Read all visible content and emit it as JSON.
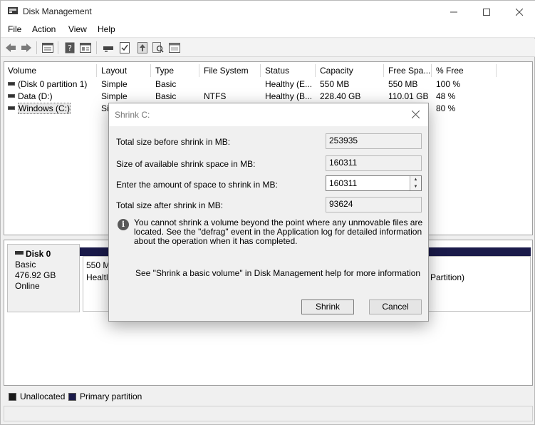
{
  "window": {
    "title": "Disk Management",
    "icon": "disk-management-icon",
    "controls": [
      "minimize-icon",
      "maximize-icon",
      "close-icon"
    ]
  },
  "menu": [
    "File",
    "Action",
    "View",
    "Help"
  ],
  "toolbar_icons": [
    "back-icon",
    "forward-icon",
    "list-view-icon",
    "help-icon",
    "properties-icon",
    "disk-icon",
    "check-icon",
    "rescan-icon",
    "search-icon",
    "console-icon"
  ],
  "volume_list": {
    "columns": [
      "Volume",
      "Layout",
      "Type",
      "File System",
      "Status",
      "Capacity",
      "Free Spa...",
      "% Free"
    ],
    "rows": [
      {
        "volume": "(Disk 0 partition 1)",
        "layout": "Simple",
        "type": "Basic",
        "fs": "",
        "status": "Healthy (E...",
        "capacity": "550 MB",
        "free": "550 MB",
        "pct": "100 %"
      },
      {
        "volume": "Data (D:)",
        "layout": "Simple",
        "type": "Basic",
        "fs": "NTFS",
        "status": "Healthy (B...",
        "capacity": "228.40 GB",
        "free": "110.01 GB",
        "pct": "48 %"
      },
      {
        "volume": "Windows (C:)",
        "layout": "Si",
        "type": "",
        "fs": "",
        "status": "",
        "capacity": "",
        "free": "",
        "pct": "80 %"
      }
    ]
  },
  "disk": {
    "name": "Disk 0",
    "type": "Basic",
    "size": "476.92 GB",
    "state": "Online",
    "partition1_line1": "550 M",
    "partition1_line2": "Healtl",
    "partition_right_text": "Partition)"
  },
  "legend": {
    "unallocated": "Unallocated",
    "primary": "Primary partition",
    "unallocated_color": "#1a1a1a",
    "primary_color": "#1a1a4a"
  },
  "dialog": {
    "title": "Shrink C:",
    "rows": [
      {
        "label": "Total size before shrink in MB:",
        "value": "253935"
      },
      {
        "label": "Size of available shrink space in MB:",
        "value": "160311"
      },
      {
        "label": "Enter the amount of space to shrink in MB:",
        "value": "160311"
      },
      {
        "label": "Total size after shrink in MB:",
        "value": "93624"
      }
    ],
    "info_text": "You cannot shrink a volume beyond the point where any unmovable files are located. See the \"defrag\" event in the Application log for detailed information about the operation when it has completed.",
    "help_text": "See \"Shrink a basic volume\" in Disk Management help for more information",
    "shrink_button": "Shrink",
    "cancel_button": "Cancel"
  }
}
